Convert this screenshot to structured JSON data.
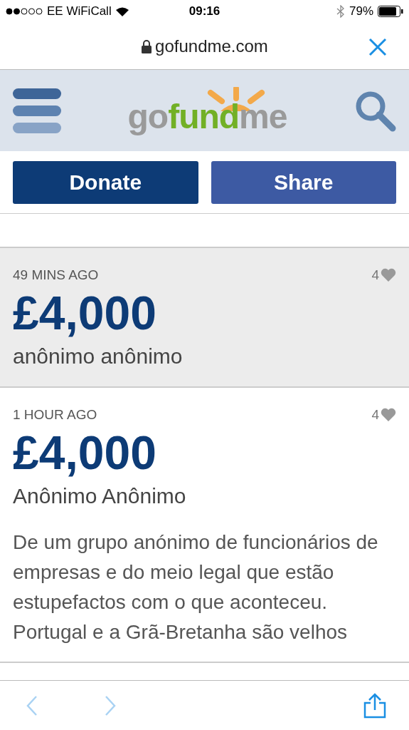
{
  "status_bar": {
    "carrier": "EE WiFiCall",
    "time": "09:16",
    "battery": "79%"
  },
  "address_bar": {
    "url": "gofundme.com"
  },
  "header": {
    "logo": [
      {
        "text": "go",
        "color": "#9a9a9a"
      },
      {
        "text": "fund",
        "color": "#72b026"
      },
      {
        "text": "me",
        "color": "#9a9a9a"
      }
    ]
  },
  "actions": [
    {
      "label": "Donate",
      "kind": "primary"
    },
    {
      "label": "Share",
      "kind": "secondary"
    }
  ],
  "donations": [
    {
      "time": "49 MINS AGO",
      "likes": "4",
      "amount": "£4,000",
      "donor": "anônimo anônimo",
      "highlighted": true
    },
    {
      "time": "1 HOUR AGO",
      "likes": "4",
      "amount": "£4,000",
      "donor": "Anônimo Anônimo",
      "highlighted": false,
      "message": "De um grupo anónimo de funcionários de empresas e do meio legal que estão estupefactos com o que aconteceu. Portugal e a Grã-Bretanha são velhos"
    }
  ]
}
